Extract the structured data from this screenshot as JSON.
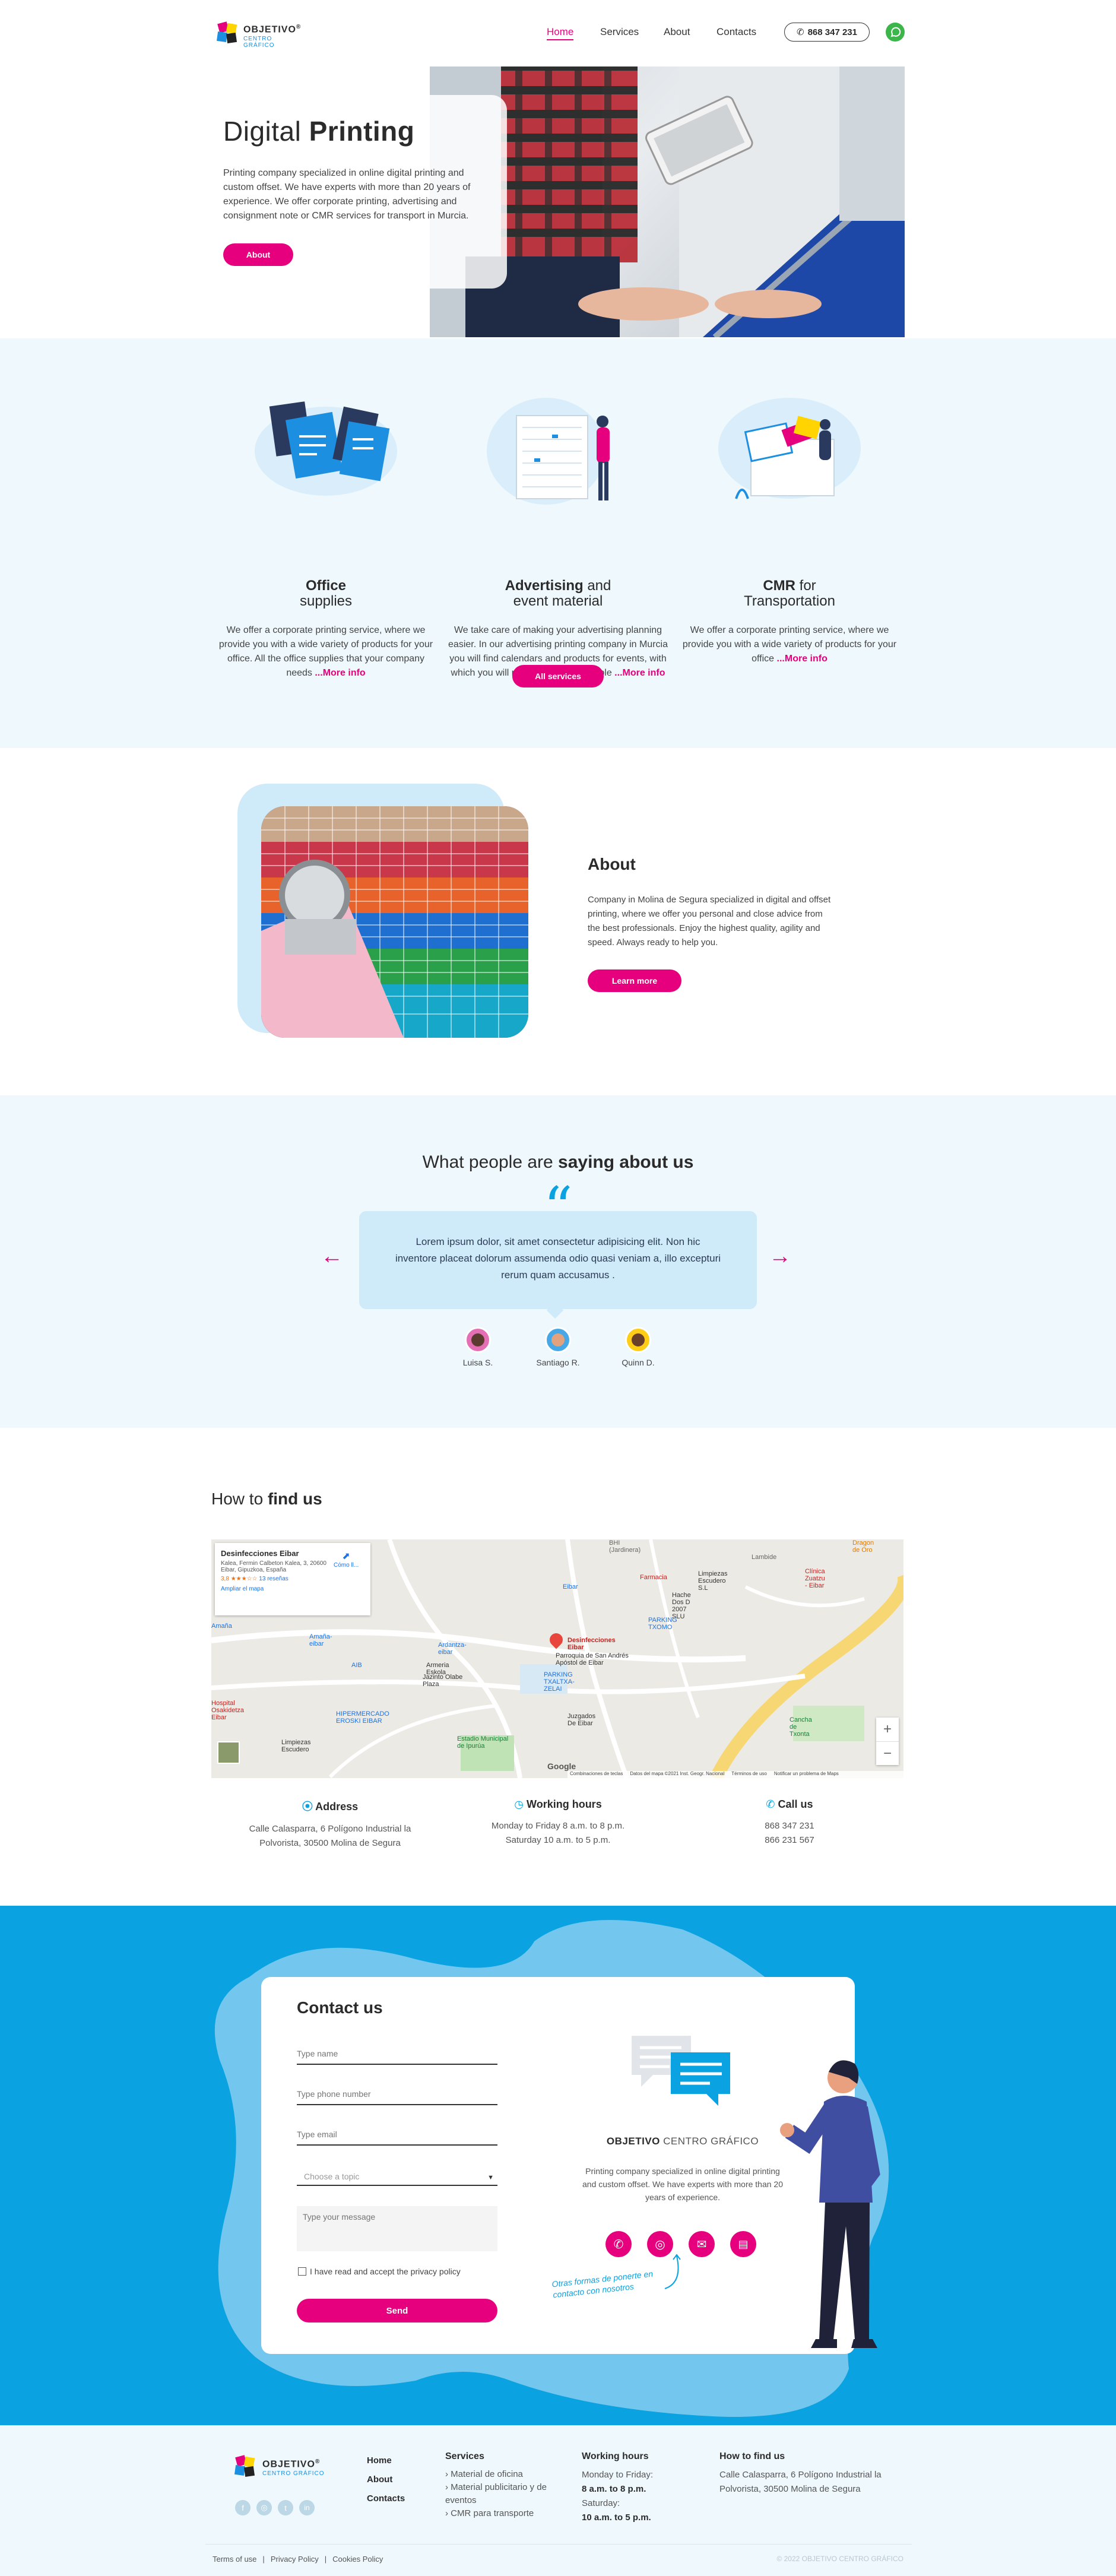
{
  "brand": {
    "name": "OBJETIVO",
    "reg": "®",
    "sub": "CENTRO GRÁFICO"
  },
  "nav": {
    "home": "Home",
    "services": "Services",
    "about": "About",
    "contacts": "Contacts",
    "phone": "868 347 231"
  },
  "hero": {
    "title_light": "Digital ",
    "title_bold": "Printing",
    "text": "Printing company specialized in online digital printing and custom offset. We have experts with more than 20 years of experience. We offer corporate printing, advertising and consignment note or CMR services for transport in Murcia.",
    "button": "About"
  },
  "services": {
    "items": [
      {
        "title_bold": "Office",
        "title_light": "supplies",
        "text": "We offer a corporate printing service, where we provide you with a wide variety of products for your office. All the office supplies that your company needs ",
        "more": "...More info"
      },
      {
        "title_bold": "Advertising",
        "title_light": " and",
        "title_line2": "event material",
        "text": "We take care of making your advertising planning easier. In our advertising printing company in Murcia you will find calendars and products for events, with which you will make your brand visible ",
        "more": "...More info"
      },
      {
        "title_bold": "CMR",
        "title_light": " for",
        "title_line2": "Transportation",
        "text": "We offer a corporate printing service, where we provide you with a wide variety of products for your office ",
        "more": "...More info"
      }
    ],
    "button": "All services"
  },
  "about": {
    "title": "About",
    "text": "Company in Molina de Segura specialized in digital and offset printing, where we offer you personal and close advice from the best professionals. Enjoy the highest quality, agility and speed. Always ready to help you.",
    "button": "Learn more"
  },
  "testimonials": {
    "title_light": "What people are ",
    "title_bold": "saying about us",
    "quote_mark": "“",
    "quote": "Lorem ipsum dolor, sit amet consectetur adipisicing elit. Non hic inventore placeat dolorum assumenda odio quasi veniam a, illo excepturi rerum quam accusamus .",
    "prev": "←",
    "next": "→",
    "people": [
      "Luisa S.",
      "Santiago R.",
      "Quinn D."
    ]
  },
  "find": {
    "title_light": "How to ",
    "title_bold": "find us",
    "map": {
      "place": "Desinfecciones Eibar",
      "address": "Kalea, Fermin Calbeton Kalea, 3, 20600 Eibar, Gipuzkoa, España",
      "rating": "3,8",
      "stars": "★★★☆☆",
      "reviews": "13 reseñas",
      "enlarge": "Ampliar el mapa",
      "directions": "Cómo ll...",
      "labels": [
        "BHI (Jardinera)",
        "Lambide",
        "Dragon de Oro",
        "Farmacia",
        "Limpiezas Escudero S.L",
        "Clínica Zuatzu - Eibar",
        "Eibar",
        "Hache Dos D 2007 SLU",
        "PARKING TXOMO",
        "Amaña",
        "Amaña-eibar",
        "Desinfecciones Eibar",
        "Ardantza-eibar",
        "Parroquia de San Andrés Apóstol de Eibar",
        "Armeria Eskola",
        "Jazinto Olabe Plaza",
        "PARKING TXALTXA-ZELAI",
        "AIB",
        "Hospital Osakidetza Eibar",
        "HIPERMERCADO EROSKI EIBAR",
        "Juzgados De Eibar",
        "Limpiezas Escudero",
        "Estadio Municipal de Ipurúa",
        "Cancha de Txonta",
        "Google",
        "Combinaciones de teclas",
        "Datos del mapa ©2021 Inst. Geogr. Nacional",
        "Términos de uso",
        "Notificar un problema de Maps"
      ],
      "zoom_in": "+",
      "zoom_out": "−"
    },
    "address": {
      "title": "Address",
      "text": "Calle Calasparra, 6 Polígono Industrial la Polvorista, 30500 Molina de Segura"
    },
    "hours": {
      "title": "Working hours",
      "line1": "Monday to Friday 8 a.m. to 8 p.m.",
      "line2": "Saturday 10 a.m. to 5 p.m."
    },
    "call": {
      "title": "Call us",
      "phone1": "868 347 231",
      "phone2": "866 231 567"
    }
  },
  "contact": {
    "title": "Contact us",
    "name_ph": "Type name",
    "phone_ph": "Type phone number",
    "email_ph": "Type email",
    "topic_ph": "Choose a topic",
    "message_ph": "Type your message",
    "privacy": "I have read and accept the privacy policy",
    "send": "Send",
    "brand_bold": "OBJETIVO",
    "brand_light": " CENTRO GRÁFICO",
    "text": "Printing company specialized in online digital printing and custom offset. We have experts with more than 20 years of experience.",
    "other": "Otras formas de ponerte en contacto con nosotros"
  },
  "footer": {
    "nav": [
      "Home",
      "About",
      "Contacts"
    ],
    "services_title": "Services",
    "services": [
      "Material de oficina",
      "Material publicitario y de eventos",
      "CMR para transporte"
    ],
    "hours_title": "Working hours",
    "hours1": "Monday to Friday:",
    "hours2": "8 a.m. to 8 p.m.",
    "hours3": "Saturday:",
    "hours4": "10 a.m. to 5 p.m.",
    "find_title": "How to find us",
    "find_text": "Calle Calasparra, 6 Polígono Industrial la Polvorista, 30500 Molina de Segura",
    "terms": "Terms of use",
    "privacy": "Privacy Policy",
    "cookies": "Cookies Policy",
    "copyright": "© 2022 OBJETIVO CENTRO GRÁFICO"
  },
  "colors": {
    "pink": "#e6007e",
    "blue": "#0aa2e0",
    "light": "#eef8fd"
  }
}
